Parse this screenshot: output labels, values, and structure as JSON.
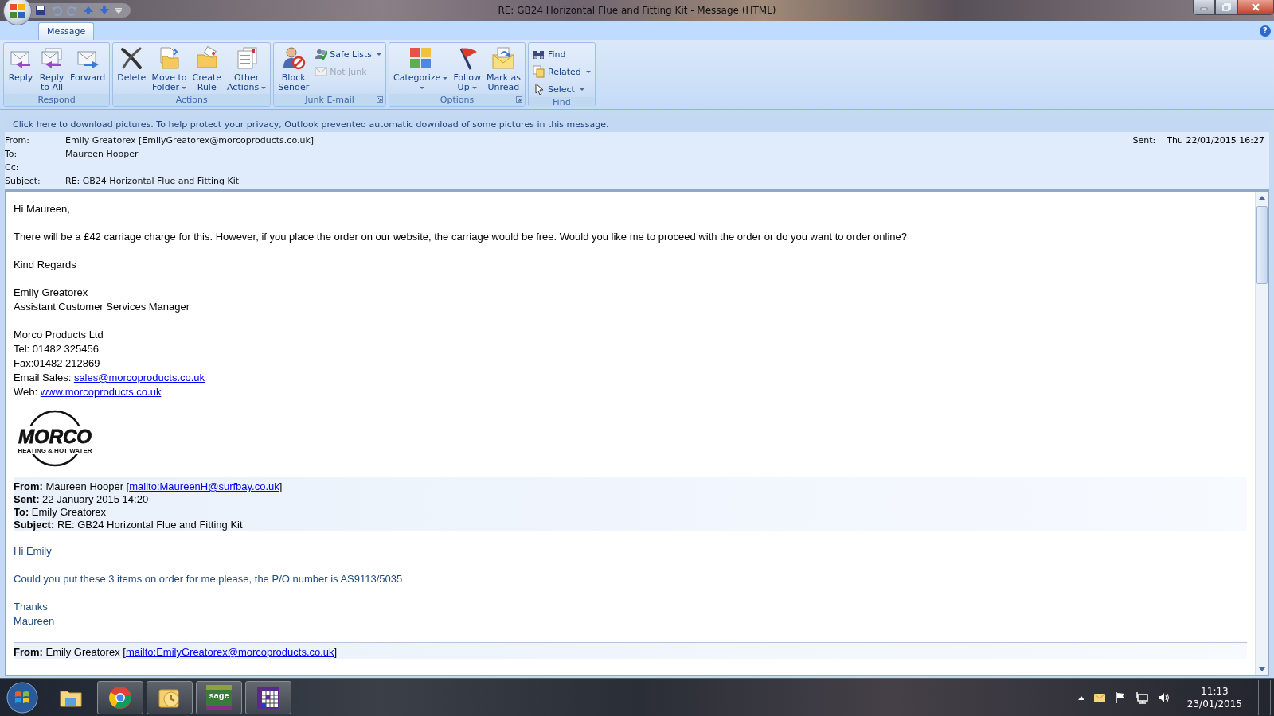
{
  "window": {
    "title": "RE: GB24 Horizontal Flue and Fitting Kit - Message (HTML)"
  },
  "ribbon": {
    "tabs": [
      {
        "label": "Message",
        "selected": true
      }
    ],
    "help": "?",
    "groups": [
      {
        "label": "Respond",
        "launcher": false,
        "items": [
          {
            "kind": "large",
            "lines": [
              "Reply"
            ],
            "dropdown": false,
            "disabled": false
          },
          {
            "kind": "large",
            "lines": [
              "Reply",
              "to All"
            ],
            "dropdown": false,
            "disabled": false
          },
          {
            "kind": "large",
            "lines": [
              "Forward"
            ],
            "dropdown": false,
            "disabled": false
          }
        ]
      },
      {
        "label": "Actions",
        "launcher": false,
        "items": [
          {
            "kind": "large",
            "lines": [
              "Delete"
            ],
            "dropdown": false,
            "disabled": false
          },
          {
            "kind": "large",
            "lines": [
              "Move to",
              "Folder"
            ],
            "dropdown": true,
            "disabled": false
          },
          {
            "kind": "large",
            "lines": [
              "Create",
              "Rule"
            ],
            "dropdown": false,
            "disabled": false
          },
          {
            "kind": "large",
            "lines": [
              "Other",
              "Actions"
            ],
            "dropdown": true,
            "disabled": false
          }
        ]
      },
      {
        "label": "Junk E-mail",
        "launcher": true,
        "items": [
          {
            "kind": "large",
            "lines": [
              "Block",
              "Sender"
            ],
            "dropdown": false,
            "disabled": false
          },
          {
            "kind": "small",
            "lines": [
              "Safe Lists"
            ],
            "dropdown": true,
            "disabled": false
          },
          {
            "kind": "small",
            "lines": [
              "Not Junk"
            ],
            "dropdown": false,
            "disabled": true
          }
        ]
      },
      {
        "label": "Options",
        "launcher": true,
        "items": [
          {
            "kind": "large",
            "lines": [
              "Categorize"
            ],
            "dropdown": true,
            "disabled": false
          },
          {
            "kind": "large",
            "lines": [
              "Follow",
              "Up"
            ],
            "dropdown": true,
            "disabled": false
          },
          {
            "kind": "large",
            "lines": [
              "Mark as",
              "Unread"
            ],
            "dropdown": false,
            "disabled": false
          }
        ]
      },
      {
        "label": "Find",
        "launcher": false,
        "items": [
          {
            "kind": "small",
            "lines": [
              "Find"
            ],
            "dropdown": false,
            "disabled": false
          },
          {
            "kind": "small",
            "lines": [
              "Related"
            ],
            "dropdown": true,
            "disabled": false
          },
          {
            "kind": "small",
            "lines": [
              "Select"
            ],
            "dropdown": true,
            "disabled": false
          }
        ]
      }
    ]
  },
  "info_bar": "Click here to download pictures. To help protect your privacy, Outlook prevented automatic download of some pictures in this message.",
  "header": {
    "fields": [
      {
        "label": "From:",
        "value": "Emily Greatorex [EmilyGreatorex@morcoproducts.co.uk]"
      },
      {
        "label": "To:",
        "value": "Maureen Hooper"
      },
      {
        "label": "Cc:"
      },
      {
        "label": "Subject:",
        "value": "RE: GB24 Horizontal Flue and Fitting Kit"
      }
    ],
    "sent": {
      "label": "Sent:",
      "value": "Thu 22/01/2015 16:27"
    }
  },
  "body": [
    {
      "kind": "text",
      "lines": [
        {
          "text": "Hi Maureen,"
        }
      ]
    },
    {
      "kind": "text",
      "lines": [
        {
          "text": "There will be a £42 carriage charge for this. However, if you place the order on our website, the carriage would be free. Would you like me to proceed with the order or do you want to order online?"
        }
      ]
    },
    {
      "kind": "text",
      "lines": [
        {
          "text": "Kind Regards"
        }
      ]
    },
    {
      "kind": "text",
      "lines": [
        {
          "text": "Emily Greatorex"
        },
        {
          "text": "Assistant Customer Services Manager"
        }
      ]
    },
    {
      "kind": "text",
      "lines": [
        {
          "text": "Morco Products Ltd"
        },
        {
          "text": "Tel: 01482 325456"
        },
        {
          "text": "Fax:01482 212869"
        },
        {
          "text": "Email Sales: ",
          "link": "sales@morcoproducts.co.uk"
        },
        {
          "text": "Web: ",
          "link": "www.morcoproducts.co.uk"
        }
      ]
    },
    {
      "kind": "logo",
      "name": "MORCO",
      "tagline": "HEATING & HOT WATER"
    },
    {
      "kind": "quote_header",
      "lines": [
        {
          "label": "From:",
          "text": " Maureen Hooper [",
          "link": "mailto:MaureenH@surfbay.co.uk",
          "after": "]"
        },
        {
          "label": "Sent:",
          "text": " 22 January 2015 14:20"
        },
        {
          "label": "To:",
          "text": " Emily Greatorex"
        },
        {
          "label": "Subject:",
          "text": " RE: GB24 Horizontal Flue and Fitting Kit"
        }
      ]
    },
    {
      "kind": "reply_text",
      "lines": [
        {
          "text": "Hi Emily"
        }
      ]
    },
    {
      "kind": "reply_text",
      "lines": [
        {
          "text": "Could you put these 3 items on order for me please, the P/O number is AS9113/5035"
        }
      ]
    },
    {
      "kind": "reply_text",
      "lines": [
        {
          "text": "Thanks"
        },
        {
          "text": "Maureen"
        }
      ]
    },
    {
      "kind": "quote_header",
      "lines": [
        {
          "label": "From:",
          "text": " Emily Greatorex [",
          "link": "mailto:EmilyGreatorex@morcoproducts.co.uk",
          "after": "]"
        }
      ]
    }
  ],
  "taskbar": {
    "apps": [
      {
        "running": false
      },
      {
        "running": true
      },
      {
        "running": true
      },
      {
        "running": true,
        "label": "sage"
      },
      {
        "running": true
      }
    ],
    "clock": {
      "time": "11:13",
      "date": "23/01/2015"
    }
  }
}
